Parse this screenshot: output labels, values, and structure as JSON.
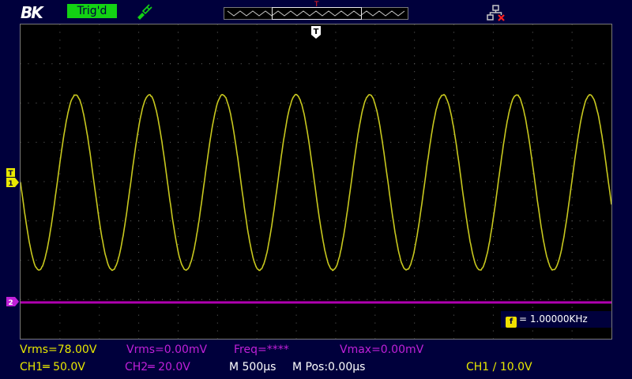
{
  "header": {
    "logo": "BK",
    "trigger_status": "Trig'd",
    "trigger_marker": "T"
  },
  "screen": {
    "trigger_position_label": "T",
    "ch1_marker_top": "T",
    "ch1_marker_bottom": "1",
    "ch2_marker": "2",
    "frequency_counter": {
      "badge": "f",
      "text": "= 1.00000KHz"
    }
  },
  "waveforms": {
    "ch1": {
      "color": "#c8c81e",
      "cycles_on_screen": 8
    },
    "ch2": {
      "color": "#b000b0"
    }
  },
  "measurements": {
    "ch1_vrms": "Vrms=78.00V",
    "ch2_vrms": "Vrms=0.00mV",
    "freq": "Freq=****",
    "vmax": "Vmax=0.00mV"
  },
  "status": {
    "ch1_scale": "CH1═ 50.0V",
    "ch2_scale": "CH2═ 20.0V",
    "timebase": "M 500µs",
    "mpos": "M Pos:0.00µs",
    "trigger": "CH1 ∕ 10.0V"
  },
  "colors": {
    "background": "#00003c",
    "ch1": "#e8e800",
    "ch2": "#c020d8",
    "trig_badge": "#13d313"
  }
}
